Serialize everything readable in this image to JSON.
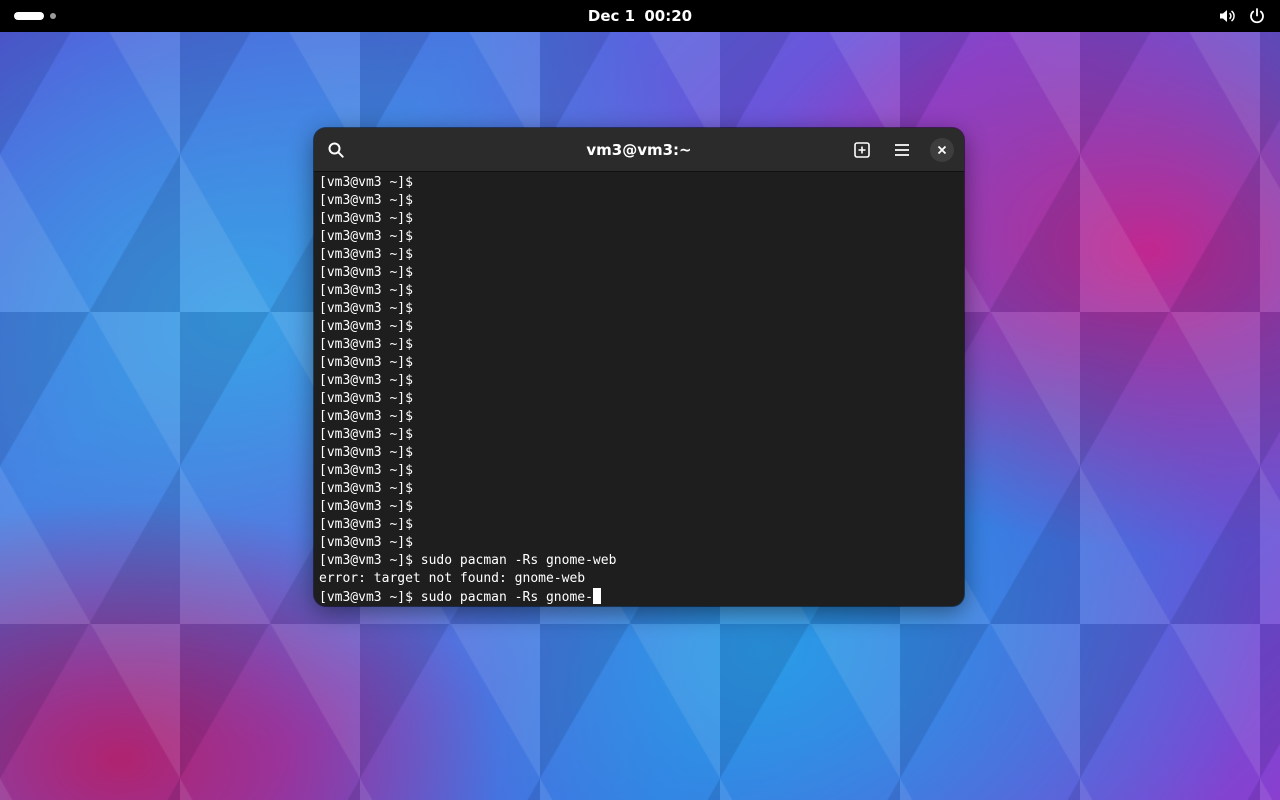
{
  "topbar": {
    "date": "Dec 1",
    "time": "00:20",
    "icons": [
      "volume-icon",
      "power-icon"
    ]
  },
  "window": {
    "title": "vm3@vm3:~",
    "buttons": [
      "search-icon",
      "new-tab-icon",
      "menu-icon",
      "close-icon"
    ]
  },
  "terminal": {
    "lines": [
      "[vm3@vm3 ~]$",
      "[vm3@vm3 ~]$",
      "[vm3@vm3 ~]$",
      "[vm3@vm3 ~]$",
      "[vm3@vm3 ~]$",
      "[vm3@vm3 ~]$",
      "[vm3@vm3 ~]$",
      "[vm3@vm3 ~]$",
      "[vm3@vm3 ~]$",
      "[vm3@vm3 ~]$",
      "[vm3@vm3 ~]$",
      "[vm3@vm3 ~]$",
      "[vm3@vm3 ~]$",
      "[vm3@vm3 ~]$",
      "[vm3@vm3 ~]$",
      "[vm3@vm3 ~]$",
      "[vm3@vm3 ~]$",
      "[vm3@vm3 ~]$",
      "[vm3@vm3 ~]$",
      "[vm3@vm3 ~]$",
      "[vm3@vm3 ~]$",
      "[vm3@vm3 ~]$ sudo pacman -Rs gnome-web",
      "error: target not found: gnome-web"
    ],
    "current_input": "[vm3@vm3 ~]$ sudo pacman -Rs gnome-"
  },
  "colors": {
    "topbar": "#000000",
    "terminal_bg": "#1e1e1e",
    "headerbar": "#2b2b2b",
    "text": "#ffffff"
  }
}
